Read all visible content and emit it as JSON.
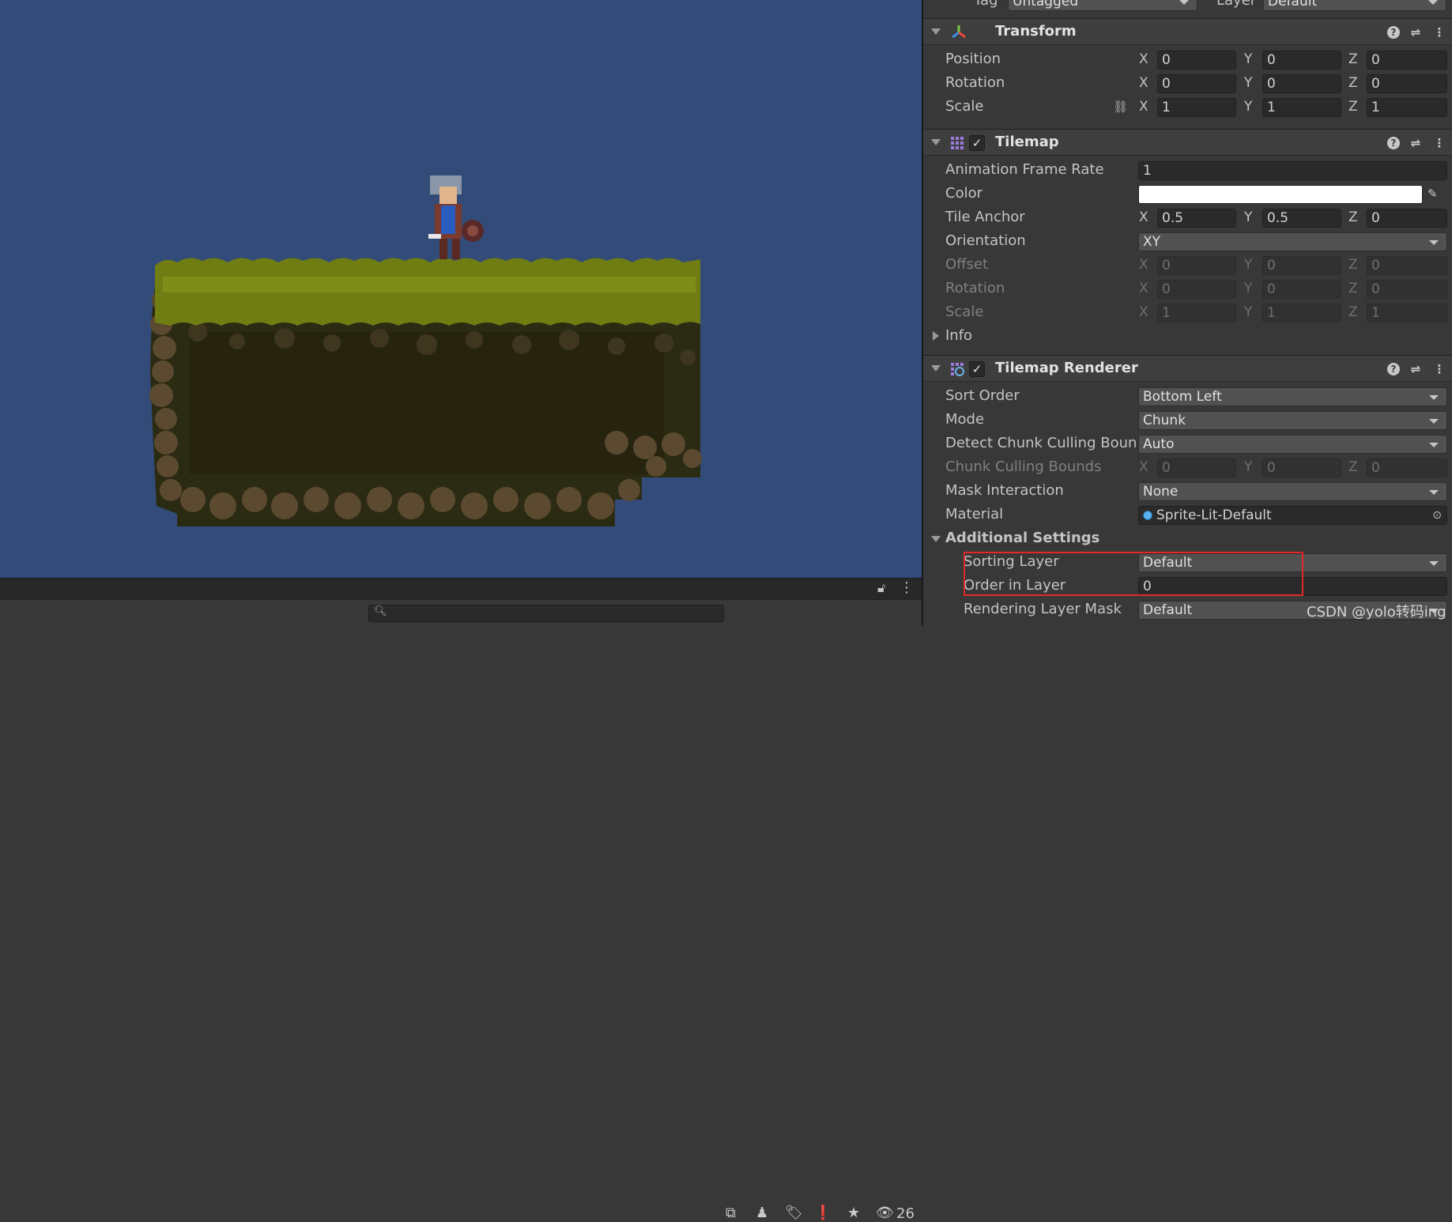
{
  "top_partial": {
    "tag_label": "Tag",
    "tag_value": "Untagged",
    "layer_label": "Layer",
    "layer_value": "Default"
  },
  "transform": {
    "title": "Transform",
    "position": {
      "label": "Position",
      "x": "0",
      "y": "0",
      "z": "0"
    },
    "rotation": {
      "label": "Rotation",
      "x": "0",
      "y": "0",
      "z": "0"
    },
    "scale": {
      "label": "Scale",
      "x": "1",
      "y": "1",
      "z": "1"
    }
  },
  "tilemap": {
    "title": "Tilemap",
    "enabled": true,
    "animation_frame_rate": {
      "label": "Animation Frame Rate",
      "value": "1"
    },
    "color": {
      "label": "Color",
      "value": "#ffffff"
    },
    "tile_anchor": {
      "label": "Tile Anchor",
      "x": "0.5",
      "y": "0.5",
      "z": "0"
    },
    "orientation": {
      "label": "Orientation",
      "value": "XY"
    },
    "offset": {
      "label": "Offset",
      "x": "0",
      "y": "0",
      "z": "0"
    },
    "rotation": {
      "label": "Rotation",
      "x": "0",
      "y": "0",
      "z": "0"
    },
    "scale": {
      "label": "Scale",
      "x": "1",
      "y": "1",
      "z": "1"
    },
    "info": {
      "label": "Info"
    }
  },
  "renderer": {
    "title": "Tilemap Renderer",
    "enabled": true,
    "sort_order": {
      "label": "Sort Order",
      "value": "Bottom Left"
    },
    "mode": {
      "label": "Mode",
      "value": "Chunk"
    },
    "detect_culling": {
      "label": "Detect Chunk Culling Boun",
      "value": "Auto"
    },
    "culling_bounds": {
      "label": "Chunk Culling Bounds",
      "x": "0",
      "y": "0",
      "z": "0"
    },
    "mask_interaction": {
      "label": "Mask Interaction",
      "value": "None"
    },
    "material": {
      "label": "Material",
      "value": "Sprite-Lit-Default"
    },
    "additional": {
      "label": "Additional Settings"
    },
    "sorting_layer": {
      "label": "Sorting Layer",
      "value": "Default"
    },
    "order_in_layer": {
      "label": "Order in Layer",
      "value": "0"
    },
    "rendering_layer_mask": {
      "label": "Rendering Layer Mask",
      "value": "Default"
    }
  },
  "axes": {
    "x": "X",
    "y": "Y",
    "z": "Z"
  },
  "scene": {
    "search_placeholder": "",
    "hidden_count": "26"
  },
  "watermark": "CSDN @yolo转码ing",
  "colors": {
    "scene_bg": "#324b78",
    "grass": "#7a8a14",
    "dirt": "#2a2a12",
    "rock": "#5a4a30",
    "highlight_box": "#e02a2a"
  },
  "icons": [
    "transform-icon",
    "tilemap-icon",
    "tilemap-renderer-icon",
    "help-icon",
    "preset-icon",
    "kebab-menu-icon",
    "unlink-scale-icon",
    "eyedropper-icon",
    "object-picker-icon",
    "lock-icon",
    "search-icon"
  ]
}
